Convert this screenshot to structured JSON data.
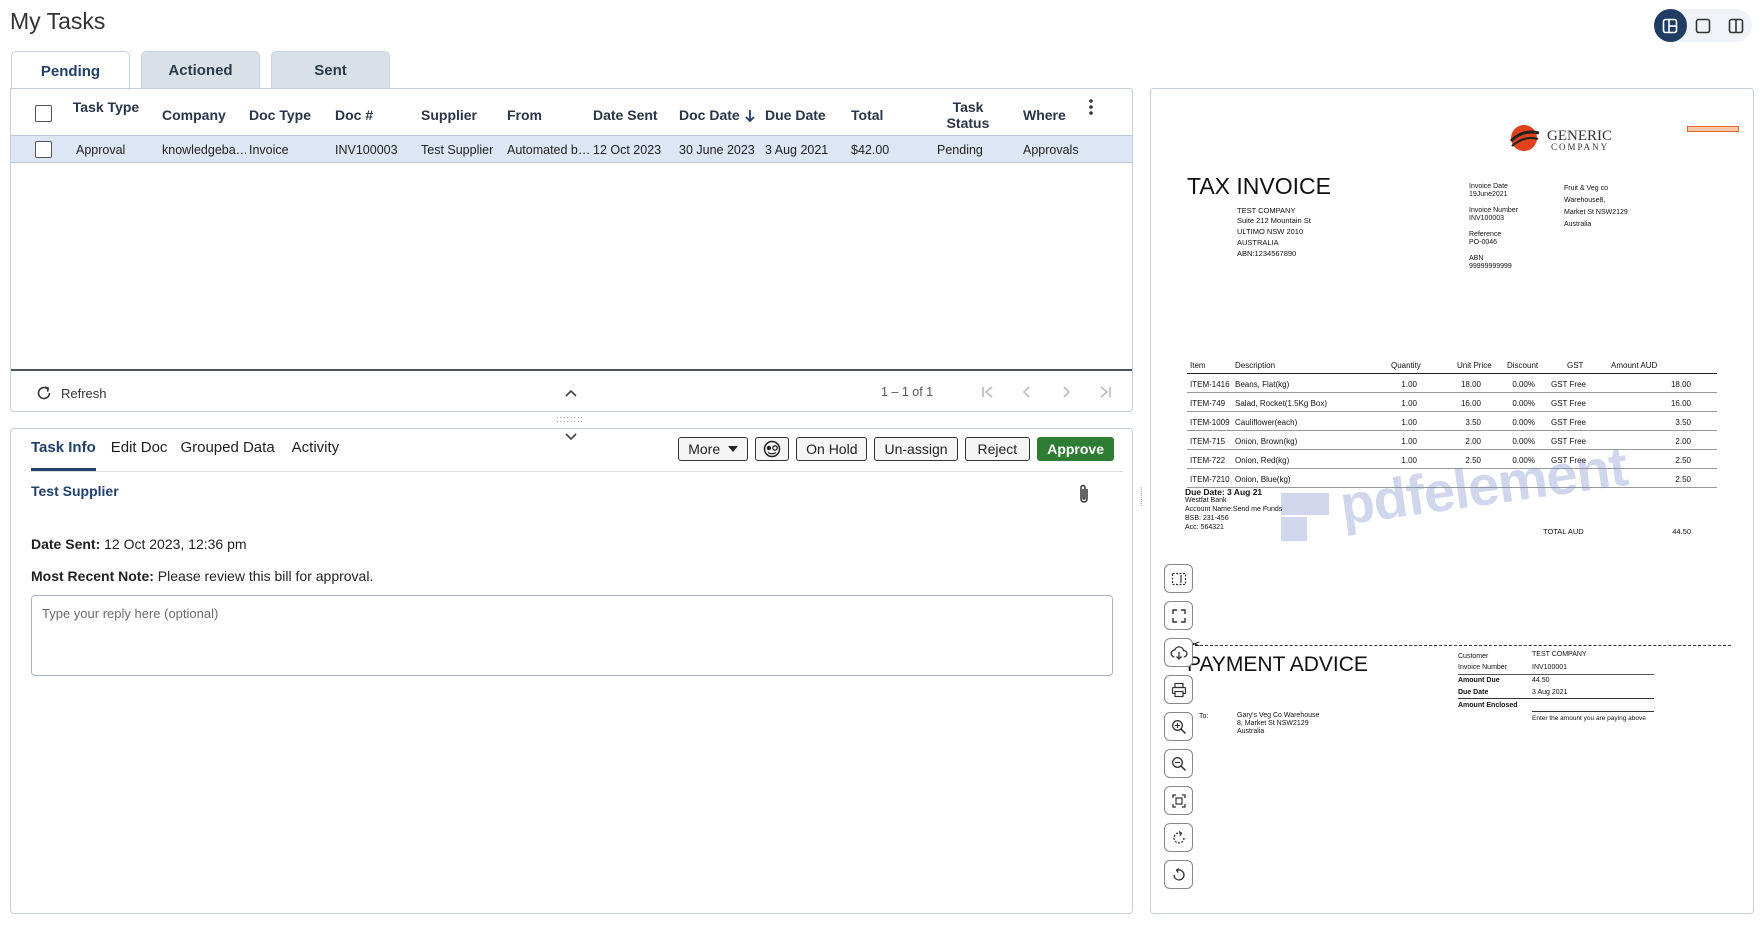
{
  "page": {
    "title": "My Tasks"
  },
  "tabs": [
    "Pending",
    "Actioned",
    "Sent"
  ],
  "grid": {
    "columns": [
      {
        "key": "task_type",
        "label": "Task Type"
      },
      {
        "key": "company",
        "label": "Company"
      },
      {
        "key": "doc_type",
        "label": "Doc Type"
      },
      {
        "key": "doc_no",
        "label": "Doc #"
      },
      {
        "key": "supplier",
        "label": "Supplier"
      },
      {
        "key": "from",
        "label": "From"
      },
      {
        "key": "date_sent",
        "label": "Date Sent"
      },
      {
        "key": "doc_date",
        "label": "Doc Date"
      },
      {
        "key": "due_date",
        "label": "Due Date"
      },
      {
        "key": "total",
        "label": "Total"
      },
      {
        "key": "task_status",
        "label": "Task Status"
      },
      {
        "key": "where",
        "label": "Where"
      }
    ],
    "rows": [
      {
        "task_type": "Approval",
        "company": "knowledgeba…",
        "doc_type": "Invoice",
        "doc_no": "INV100003",
        "supplier": "Test Supplier",
        "from": "Automated b…",
        "date_sent": "12 Oct 2023",
        "doc_date": "30 June 2023",
        "due_date": "3 Aug 2021",
        "total": "$42.00",
        "task_status": "Pending",
        "where": "Approvals"
      }
    ],
    "refresh_label": "Refresh",
    "pager_text": "1 – 1 of 1"
  },
  "detail": {
    "tabs": [
      "Task Info",
      "Edit Doc",
      "Grouped Data",
      "Activity"
    ],
    "actions": {
      "more": "More",
      "on_hold": "On Hold",
      "unassign": "Un-assign",
      "reject": "Reject",
      "approve": "Approve"
    },
    "supplier_name": "Test Supplier",
    "date_sent_label": "Date Sent:",
    "date_sent_value": "12 Oct 2023, 12:36 pm",
    "note_label": "Most Recent Note:",
    "note_value": "Please review this bill for approval.",
    "reply_placeholder": "Type your reply here (optional)"
  },
  "document": {
    "logo_line1": "GENERIC",
    "logo_line2": "COMPANY",
    "title": "TAX INVOICE",
    "bill_to": [
      "TEST COMPANY",
      "Suite 212 Mountain St",
      "ULTIMO NSW 2010",
      "AUSTRALIA",
      "ABN:1234567890"
    ],
    "meta": [
      {
        "label": "Invoice Date",
        "value": "19June2021"
      },
      {
        "label": "Invoice Number",
        "value": "INV100003"
      },
      {
        "label": "Reference",
        "value": "PO-0046"
      },
      {
        "label": "ABN",
        "value": "99999999999"
      }
    ],
    "from_address": [
      "Fruit & Veg co",
      "Warehouse8,",
      "Market St NSW2129",
      "Australia"
    ],
    "table_headers": [
      "Item",
      "Description",
      "Quantity",
      "Unit Price",
      "Discount",
      "GST",
      "Amount AUD"
    ],
    "items": [
      {
        "item": "ITEM-1416",
        "desc": "Beans, Flat(kg)",
        "qty": "1.00",
        "price": "18.00",
        "disc": "0.00%",
        "gst": "GST Free",
        "amount": "18.00"
      },
      {
        "item": "ITEM-749",
        "desc": "Salad, Rocket(1.5Kg Box)",
        "qty": "1.00",
        "price": "16.00",
        "disc": "0.00%",
        "gst": "GST Free",
        "amount": "16.00"
      },
      {
        "item": "ITEM-1009",
        "desc": "Cauliflower(each)",
        "qty": "1.00",
        "price": "3.50",
        "disc": "0.00%",
        "gst": "GST Free",
        "amount": "3.50"
      },
      {
        "item": "ITEM-715",
        "desc": "Onion, Brown(kg)",
        "qty": "1.00",
        "price": "2.00",
        "disc": "0.00%",
        "gst": "GST Free",
        "amount": "2.00"
      },
      {
        "item": "ITEM-722",
        "desc": "Onion, Red(kg)",
        "qty": "1.00",
        "price": "2.50",
        "disc": "0.00%",
        "gst": "GST Free",
        "amount": "2.50"
      },
      {
        "item": "ITEM-7210",
        "desc": "Onion, Blue(kg)",
        "qty": "",
        "price": "",
        "disc": "",
        "gst": "",
        "amount": "2.50"
      }
    ],
    "total_label": "TOTAL AUD",
    "total_value": "44.50",
    "watermark": "pdfelement",
    "due_date": "Due Date: 3 Aug 21",
    "bank": [
      "Westfat Bank",
      "Account Name:Send me Funds",
      "BSB: 231-456",
      "Acc: 564321"
    ],
    "payment_title": "PAYMENT ADVICE",
    "payment": [
      {
        "label": "Customer",
        "value": "TEST COMPANY"
      },
      {
        "label": "Invoice Number",
        "value": "INV100001"
      },
      {
        "label": "Amount Due",
        "value": "44.50"
      },
      {
        "label": "Due Date",
        "value": "3 Aug 2021"
      },
      {
        "label": "Amount Enclosed",
        "value": ""
      }
    ],
    "enclosed_hint": "Enter the amount you are paying above",
    "to_label": "To:",
    "to_address": [
      "Gary's Veg Co Warehouse",
      "8, Market St NSW2129",
      "Australia"
    ]
  },
  "colors": {
    "accent": "#23406b",
    "approve": "#2e7d32",
    "row_selected": "#dce6f5"
  },
  "icons": [
    "layout-split-icon",
    "layout-single-icon",
    "layout-columns-icon",
    "refresh-icon",
    "sort-down-icon",
    "kebab-icon",
    "paperclip-icon",
    "user-face-icon",
    "text-select-icon",
    "fit-screen-icon",
    "download-cloud-icon",
    "print-icon",
    "zoom-in-icon",
    "zoom-out-icon",
    "fit-width-icon",
    "rotate-right-icon",
    "rotate-left-icon"
  ]
}
